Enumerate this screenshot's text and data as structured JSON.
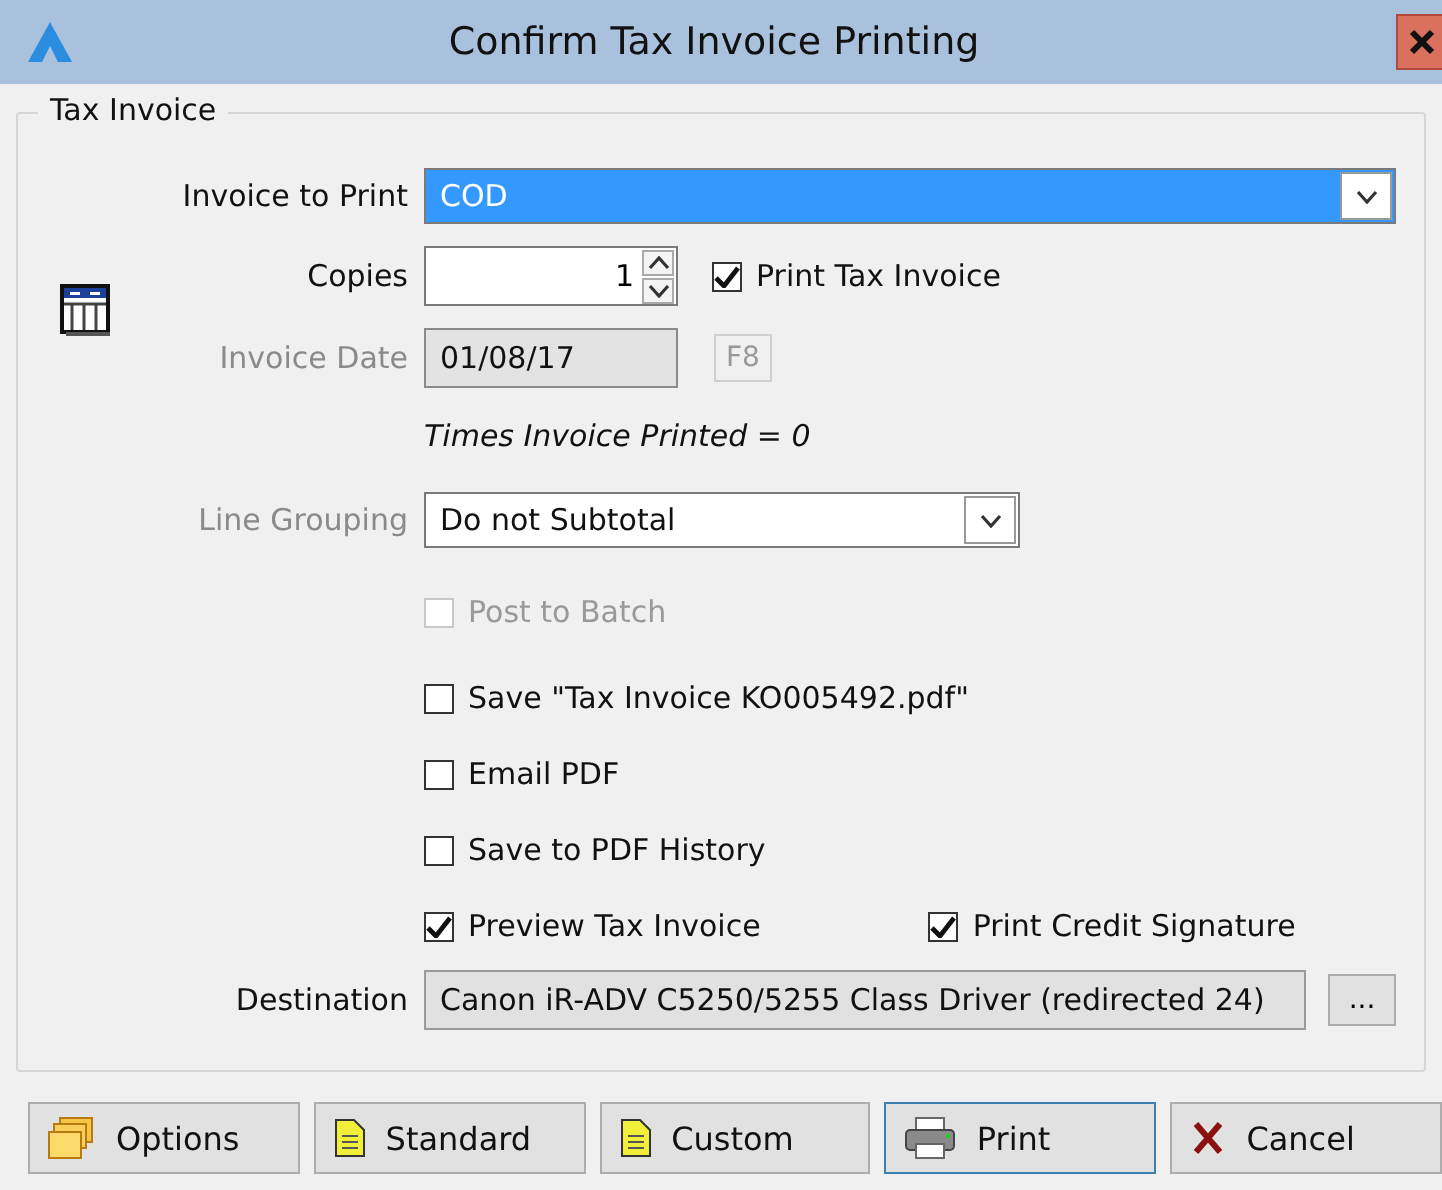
{
  "window": {
    "title": "Confirm Tax Invoice Printing"
  },
  "group": {
    "title": "Tax Invoice"
  },
  "invoice_to_print": {
    "label": "Invoice to Print",
    "value": "COD"
  },
  "copies": {
    "label": "Copies",
    "value": "1"
  },
  "print_tax_invoice": {
    "label": "Print Tax Invoice",
    "checked": true,
    "disabled": false
  },
  "invoice_date": {
    "label": "Invoice Date",
    "value": "01/08/17",
    "disabled": true,
    "key_button": "F8"
  },
  "times_printed": "Times Invoice Printed = 0",
  "line_grouping": {
    "label": "Line Grouping",
    "value": "Do not Subtotal",
    "label_disabled": true
  },
  "options": [
    {
      "label": "Post to Batch",
      "checked": false,
      "disabled": true
    },
    {
      "label": "Save \"Tax Invoice KO005492.pdf\"",
      "checked": false,
      "disabled": false
    },
    {
      "label": "Email PDF",
      "checked": false,
      "disabled": false
    },
    {
      "label": "Save to PDF History",
      "checked": false,
      "disabled": false
    }
  ],
  "options_row": [
    {
      "label": "Preview Tax Invoice",
      "checked": true,
      "disabled": false
    },
    {
      "label": "Print Credit Signature",
      "checked": true,
      "disabled": false
    }
  ],
  "destination": {
    "label": "Destination",
    "value": "Canon iR-ADV C5250/5255 Class Driver (redirected 24)",
    "browse": "..."
  },
  "buttons": [
    {
      "label": "Options",
      "kind": "options",
      "default": false
    },
    {
      "label": "Standard",
      "kind": "standard",
      "default": false
    },
    {
      "label": "Custom",
      "kind": "custom",
      "default": false
    },
    {
      "label": "Print",
      "kind": "print",
      "default": true
    },
    {
      "label": "Cancel",
      "kind": "cancel",
      "default": false
    }
  ]
}
